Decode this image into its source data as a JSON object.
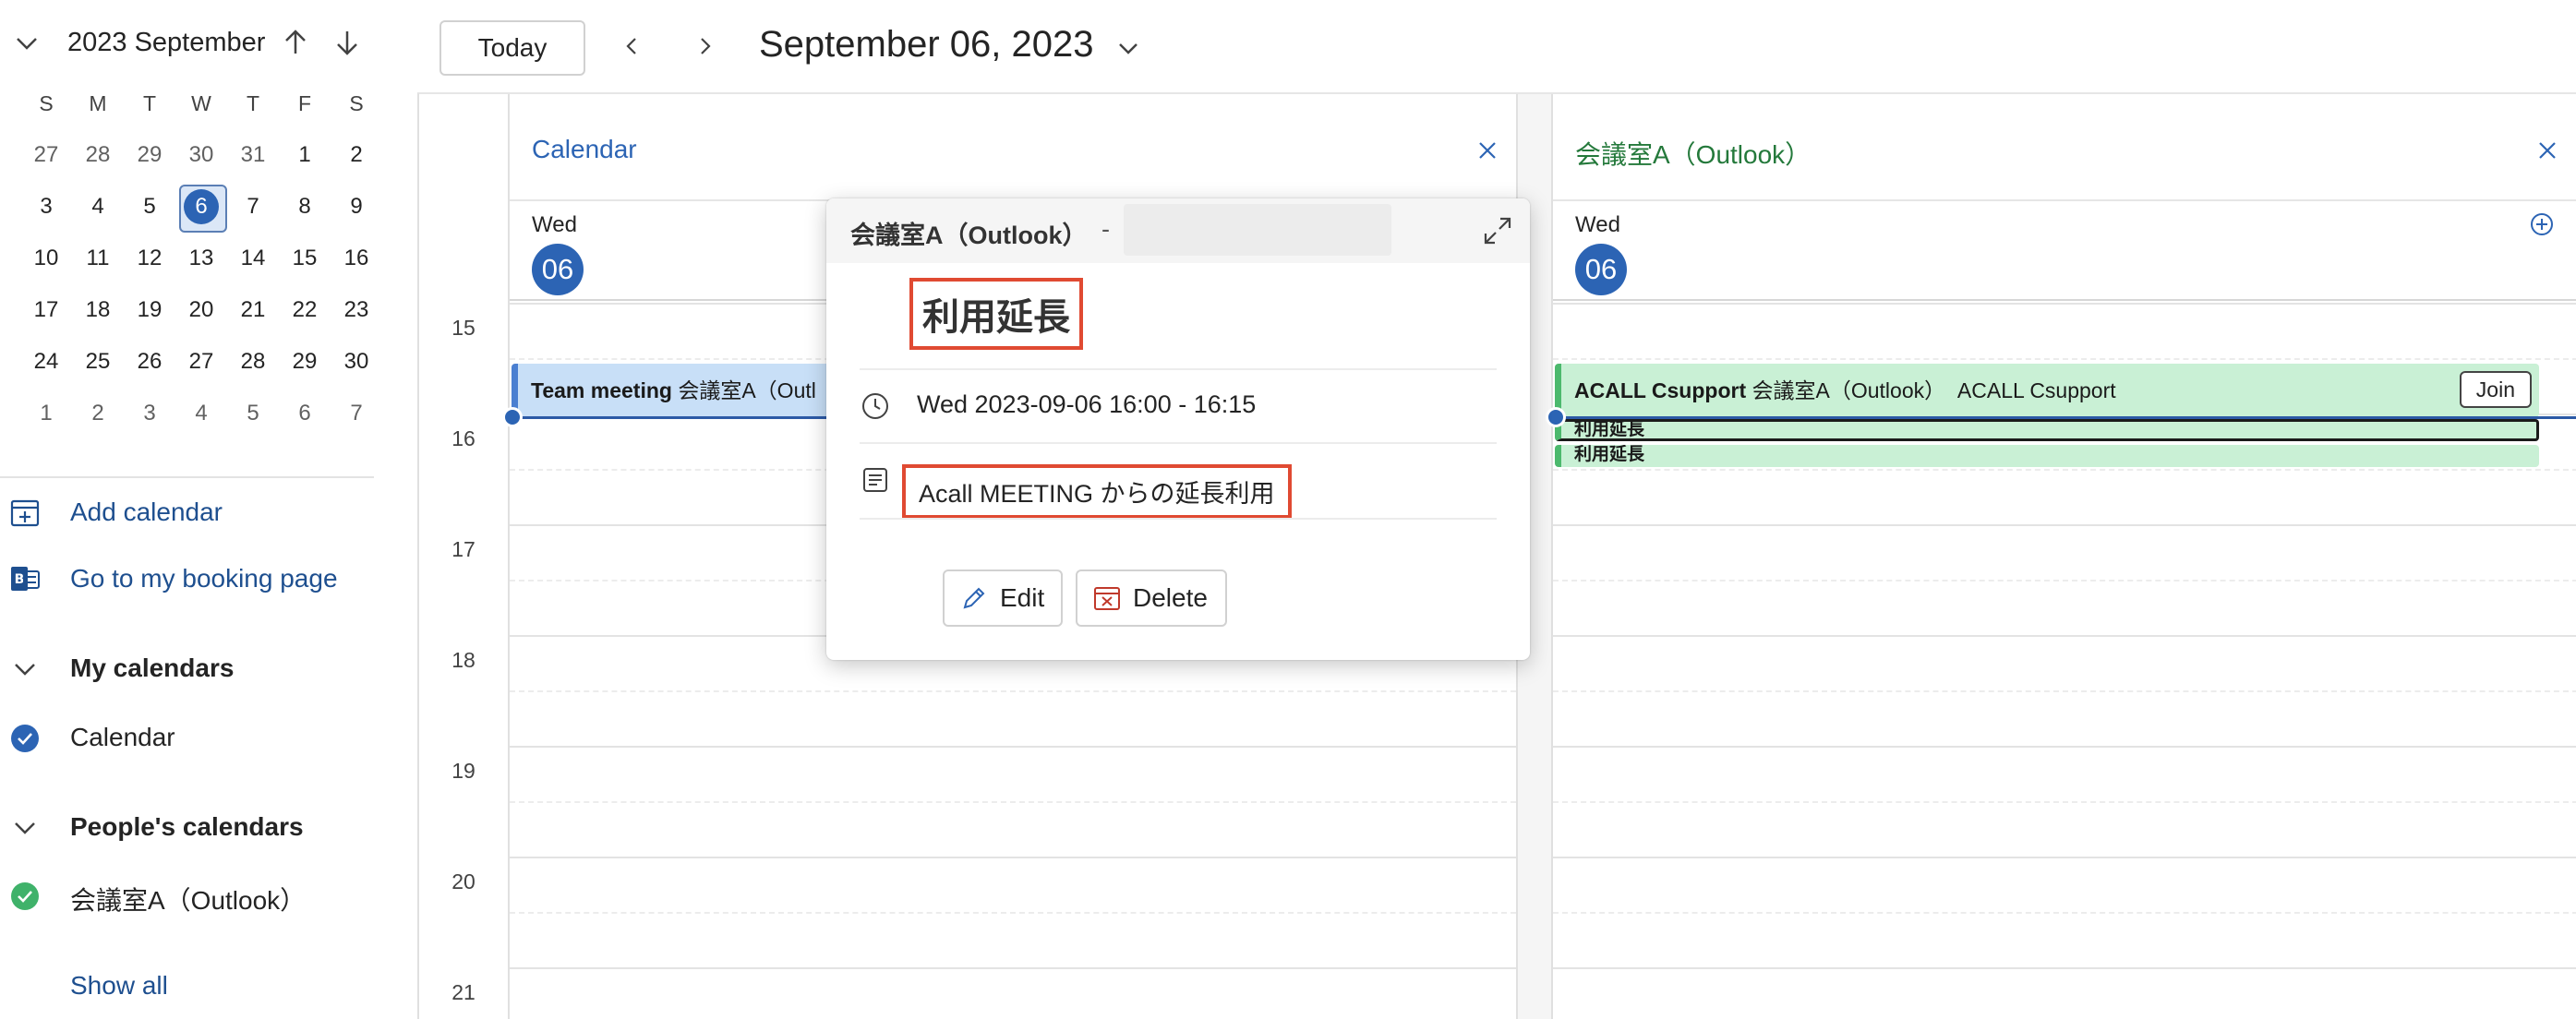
{
  "sidebar": {
    "month_label": "2023 September",
    "weekday_headers": [
      "S",
      "M",
      "T",
      "W",
      "T",
      "F",
      "S"
    ],
    "weeks": [
      [
        "27",
        "28",
        "29",
        "30",
        "31",
        "1",
        "2"
      ],
      [
        "3",
        "4",
        "5",
        "6",
        "7",
        "8",
        "9"
      ],
      [
        "10",
        "11",
        "12",
        "13",
        "14",
        "15",
        "16"
      ],
      [
        "17",
        "18",
        "19",
        "20",
        "21",
        "22",
        "23"
      ],
      [
        "24",
        "25",
        "26",
        "27",
        "28",
        "29",
        "30"
      ],
      [
        "1",
        "2",
        "3",
        "4",
        "5",
        "6",
        "7"
      ]
    ],
    "selected_day": "6",
    "add_calendar": "Add calendar",
    "booking_page": "Go to my booking page",
    "my_calendars_header": "My calendars",
    "my_calendars": [
      {
        "name": "Calendar",
        "color": "#2c64b4"
      }
    ],
    "peoples_calendars_header": "People's calendars",
    "peoples_calendars": [
      {
        "name": "会議室A（Outlook）",
        "color": "#3fb26a"
      }
    ],
    "show_all": "Show all"
  },
  "toolbar": {
    "today_label": "Today",
    "current_date": "September 06, 2023"
  },
  "hours": [
    "15",
    "16",
    "17",
    "18",
    "19",
    "20",
    "21"
  ],
  "columns": [
    {
      "title": "Calendar",
      "weekday": "Wed",
      "day": "06",
      "events": [
        {
          "title": "Team meeting",
          "location": "会議室A（Outl"
        }
      ]
    },
    {
      "title": "会議室A（Outlook）",
      "weekday": "Wed",
      "day": "06",
      "events": [
        {
          "title": "ACALL Csupport",
          "location": "会議室A（Outlook）",
          "organizer": "ACALL Csupport",
          "join_label": "Join"
        },
        {
          "title": "利用延長"
        },
        {
          "title": "利用延長"
        }
      ]
    }
  ],
  "popup": {
    "calendar_name": "会議室A（Outlook）",
    "dash": "-",
    "title": "利用延長",
    "time": "Wed 2023-09-06 16:00 - 16:15",
    "description": "Acall MEETING からの延長利用",
    "edit_label": "Edit",
    "delete_label": "Delete"
  },
  "colors": {
    "accent": "#2c64b4",
    "room_accent": "#24793b",
    "highlight_box": "#e04a32"
  }
}
